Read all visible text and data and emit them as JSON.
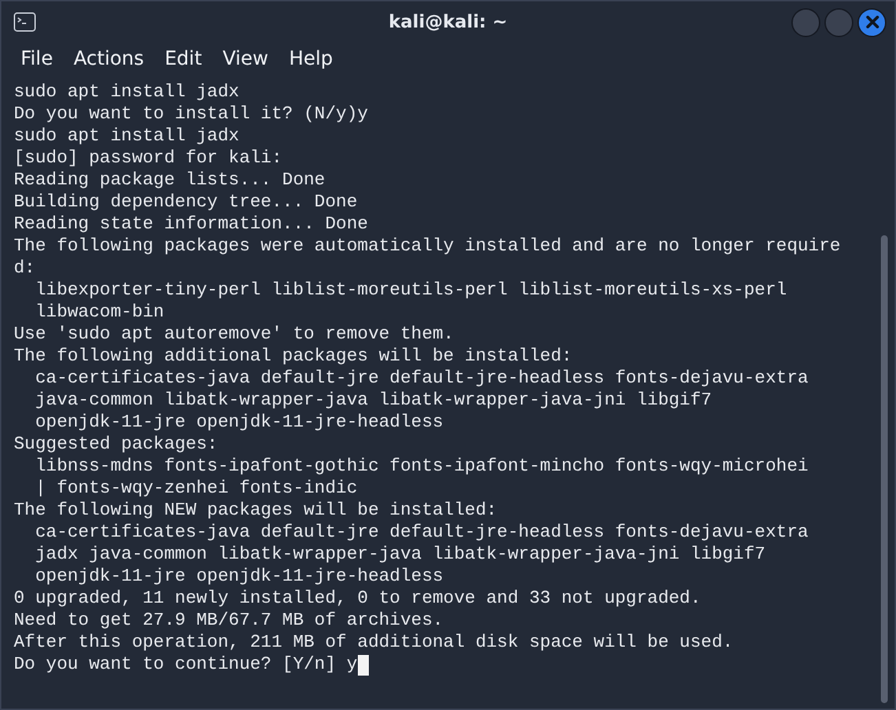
{
  "window": {
    "title": "kali@kali: ~"
  },
  "menu": [
    "File",
    "Actions",
    "Edit",
    "View",
    "Help"
  ],
  "terminal": {
    "lines": [
      "sudo apt install jadx",
      "Do you want to install it? (N/y)y",
      "sudo apt install jadx",
      "[sudo] password for kali:",
      "Reading package lists... Done",
      "Building dependency tree... Done",
      "Reading state information... Done",
      "The following packages were automatically installed and are no longer require",
      "d:",
      "  libexporter-tiny-perl liblist-moreutils-perl liblist-moreutils-xs-perl",
      "  libwacom-bin",
      "Use 'sudo apt autoremove' to remove them.",
      "The following additional packages will be installed:",
      "  ca-certificates-java default-jre default-jre-headless fonts-dejavu-extra",
      "  java-common libatk-wrapper-java libatk-wrapper-java-jni libgif7",
      "  openjdk-11-jre openjdk-11-jre-headless",
      "Suggested packages:",
      "  libnss-mdns fonts-ipafont-gothic fonts-ipafont-mincho fonts-wqy-microhei",
      "  | fonts-wqy-zenhei fonts-indic",
      "The following NEW packages will be installed:",
      "  ca-certificates-java default-jre default-jre-headless fonts-dejavu-extra",
      "  jadx java-common libatk-wrapper-java libatk-wrapper-java-jni libgif7",
      "  openjdk-11-jre openjdk-11-jre-headless",
      "0 upgraded, 11 newly installed, 0 to remove and 33 not upgraded.",
      "Need to get 27.9 MB/67.7 MB of archives.",
      "After this operation, 211 MB of additional disk space will be used."
    ],
    "input_line": "Do you want to continue? [Y/n] y"
  }
}
